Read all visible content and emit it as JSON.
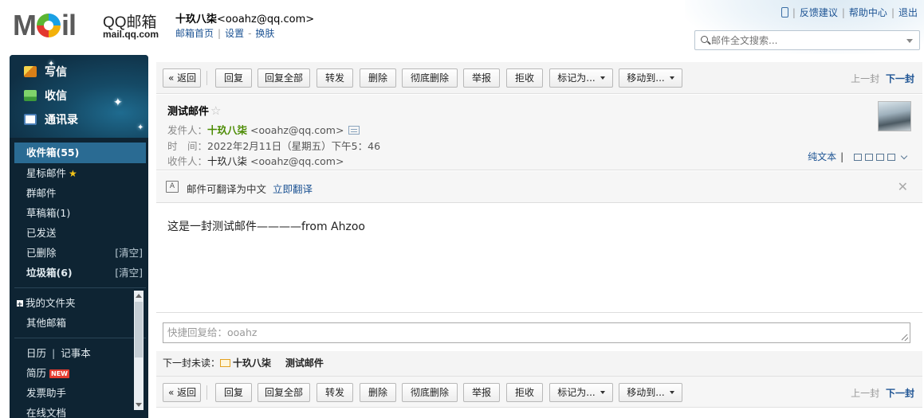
{
  "header": {
    "logo_moil_left": "M",
    "logo_moil_right": "il",
    "logo_name": "QQ邮箱",
    "logo_url": "mail.qq.com",
    "user_display": "十玖八柒",
    "user_email": "<ooahz@qq.com>",
    "links": [
      "邮箱首页",
      "设置",
      "换肤"
    ],
    "top_right_links": [
      "反馈建议",
      "帮助中心",
      "退出"
    ],
    "search_placeholder": "邮件全文搜索..."
  },
  "sidebar": {
    "actions": [
      "写信",
      "收信",
      "通讯录"
    ],
    "folders": [
      {
        "label": "收件箱(55)"
      },
      {
        "label": "星标邮件"
      },
      {
        "label": "群邮件"
      },
      {
        "label": "草稿箱(1)"
      },
      {
        "label": "已发送"
      },
      {
        "label": "已删除",
        "extra": "[清空]"
      },
      {
        "label": "垃圾箱(6)",
        "extra": "[清空]"
      }
    ],
    "my_folders": "我的文件夹",
    "other_mail": "其他邮箱",
    "calendar": "日历",
    "notes": "记事本",
    "resume": "简历",
    "new_badge": "NEW",
    "invoice": "发票助手",
    "online_docs": "在线文档"
  },
  "toolbar": {
    "back": "« 返回",
    "reply": "回复",
    "reply_all": "回复全部",
    "forward": "转发",
    "delete": "删除",
    "delete_perm": "彻底删除",
    "report": "举报",
    "reject": "拒收",
    "mark_as": "标记为...",
    "move_to": "移动到...",
    "prev": "上一封",
    "next": "下一封"
  },
  "mail": {
    "subject": "测试邮件",
    "star": "☆",
    "from_label": "发件人：",
    "from_name": "十玖八柒",
    "from_email": "<ooahz@qq.com>",
    "time_label": "时　间：",
    "time_value": "2022年2月11日（星期五）下午5：46",
    "to_label": "收件人：",
    "to_name": "十玖八柒",
    "to_email": "<ooahz@qq.com>",
    "plain_text": "纯文本",
    "translate_text": "邮件可翻译为中文",
    "translate_link": "立即翻译",
    "body": "这是一封测试邮件————from Ahzoo",
    "quick_reply_placeholder": "快捷回复给：ooahz",
    "next_unread_label": "下一封未读：",
    "next_unread_sender": "十玖八柒",
    "next_unread_subject": "测试邮件"
  }
}
